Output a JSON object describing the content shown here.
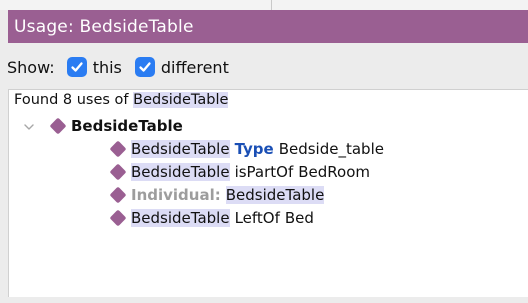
{
  "window": {
    "title": "Usage: BedsideTable"
  },
  "show": {
    "label": "Show:",
    "options": [
      {
        "label": "this",
        "checked": true
      },
      {
        "label": "different",
        "checked": true
      }
    ]
  },
  "usage": {
    "found_prefix": "Found 8 uses of",
    "found_entity": "BedsideTable",
    "root": {
      "label": "BedsideTable",
      "expanded": true,
      "icon": "individual-diamond-icon"
    },
    "items": [
      {
        "subject": "BedsideTable",
        "predicate": "Type",
        "object": "Bedside_table"
      },
      {
        "subject": "BedsideTable",
        "predicate": "isPartOf",
        "object": "BedRoom"
      },
      {
        "prefix": "Individual:",
        "entity": "BedsideTable"
      },
      {
        "subject": "BedsideTable",
        "predicate": "LeftOf",
        "object": "Bed"
      }
    ]
  },
  "colors": {
    "accent": "#9a5f92",
    "checkbox": "#2a7cf2",
    "highlight": "#dcdcf5",
    "keyword": "#1a4fb5"
  }
}
